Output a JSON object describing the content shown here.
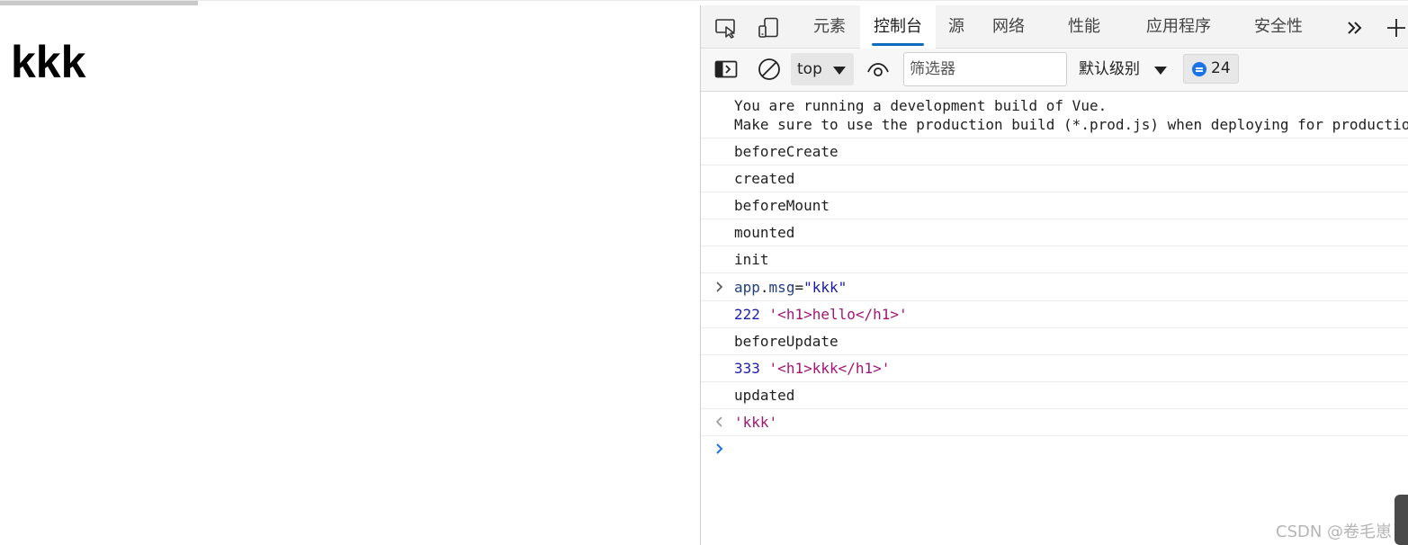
{
  "page": {
    "heading": "kkk"
  },
  "devtools": {
    "tabs": [
      {
        "label": "元素",
        "active": false
      },
      {
        "label": "控制台",
        "active": true
      },
      {
        "label": "源",
        "active": false
      },
      {
        "label": "网络",
        "active": false
      },
      {
        "label": "性能",
        "active": false
      },
      {
        "label": "应用程序",
        "active": false
      },
      {
        "label": "安全性",
        "active": false
      }
    ],
    "toolbar": {
      "context": "top",
      "filter_placeholder": "筛选器",
      "level": "默认级别",
      "message_count": "24"
    },
    "console": {
      "vue_warning_line1": "You are running a development build of Vue.",
      "vue_warning_line2": "Make sure to use the production build (*.prod.js) when deploying for production.",
      "logs": [
        "beforeCreate",
        "created",
        "beforeMount",
        "mounted",
        "init"
      ],
      "input_command": {
        "object": "app",
        "dot": ".",
        "prop": "msg",
        "equals": "=",
        "value": "\"kkk\""
      },
      "log_222_num": "222",
      "log_222_str": "'<h1>hello</h1>'",
      "log_before_update": "beforeUpdate",
      "log_333_num": "333",
      "log_333_str": "'<h1>kkk</h1>'",
      "log_updated": "updated",
      "result": "'kkk'"
    },
    "icons": {
      "inspect": "inspect-element-icon",
      "device": "device-toolbar-icon",
      "more_tabs": "chevron-double-right-icon",
      "add_tab": "plus-icon",
      "sidebar": "sidebar-toggle-icon",
      "clear": "clear-console-icon",
      "live_expression": "eye-icon",
      "messages": "message-bubble-icon"
    },
    "colors": {
      "active_tab_underline": "#0f6cbd",
      "message_badge": "#1a73e8",
      "string": "#a31515",
      "number": "#1c1cad"
    }
  },
  "watermark": "CSDN @卷毛崽"
}
